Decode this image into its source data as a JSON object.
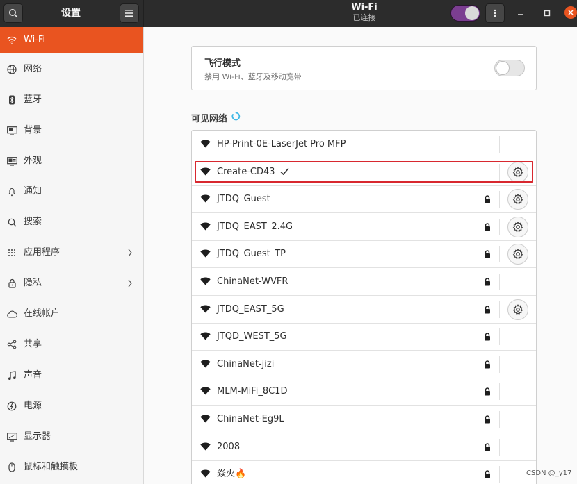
{
  "header": {
    "settings_title": "设置",
    "page_title": "Wi-Fi",
    "page_subtitle": "已连接",
    "wifi_enabled": true
  },
  "sidebar": {
    "items": [
      {
        "label": "Wi-Fi",
        "icon": "wifi-icon",
        "active": true
      },
      {
        "label": "网络",
        "icon": "network-icon"
      },
      {
        "label": "蓝牙",
        "icon": "bluetooth-icon"
      },
      {
        "label": "背景",
        "icon": "background-icon"
      },
      {
        "label": "外观",
        "icon": "appearance-icon"
      },
      {
        "label": "通知",
        "icon": "bell-icon"
      },
      {
        "label": "搜索",
        "icon": "search-icon"
      },
      {
        "label": "应用程序",
        "icon": "apps-grid-icon",
        "has_arrow": true
      },
      {
        "label": "隐私",
        "icon": "lock-icon",
        "has_arrow": true
      },
      {
        "label": "在线帐户",
        "icon": "cloud-icon"
      },
      {
        "label": "共享",
        "icon": "share-icon"
      },
      {
        "label": "声音",
        "icon": "music-note-icon"
      },
      {
        "label": "电源",
        "icon": "power-icon"
      },
      {
        "label": "显示器",
        "icon": "display-icon"
      },
      {
        "label": "鼠标和触摸板",
        "icon": "mouse-icon"
      }
    ]
  },
  "airplane": {
    "title": "飞行模式",
    "description": "禁用 Wi-Fi、蓝牙及移动宽带",
    "enabled": false
  },
  "networks_section": {
    "title": "可见网络"
  },
  "networks": [
    {
      "name": "HP-Print-0E-LaserJet Pro MFP",
      "locked": false,
      "has_settings": false,
      "connected": false
    },
    {
      "name": "Create-CD43",
      "locked": false,
      "has_settings": true,
      "connected": true
    },
    {
      "name": "JTDQ_Guest",
      "locked": true,
      "has_settings": true,
      "connected": false
    },
    {
      "name": "JTDQ_EAST_2.4G",
      "locked": true,
      "has_settings": true,
      "connected": false
    },
    {
      "name": "JTDQ_Guest_TP",
      "locked": true,
      "has_settings": true,
      "connected": false
    },
    {
      "name": "ChinaNet-WVFR",
      "locked": true,
      "has_settings": false,
      "connected": false
    },
    {
      "name": "JTDQ_EAST_5G",
      "locked": true,
      "has_settings": true,
      "connected": false
    },
    {
      "name": "JTQD_WEST_5G",
      "locked": true,
      "has_settings": false,
      "connected": false
    },
    {
      "name": "ChinaNet-jizi",
      "locked": true,
      "has_settings": false,
      "connected": false
    },
    {
      "name": "MLM-MiFi_8C1D",
      "locked": true,
      "has_settings": false,
      "connected": false
    },
    {
      "name": "ChinaNet-Eg9L",
      "locked": true,
      "has_settings": false,
      "connected": false
    },
    {
      "name": "2008",
      "locked": true,
      "has_settings": false,
      "connected": false
    },
    {
      "name": "焱火🔥",
      "locked": true,
      "has_settings": false,
      "connected": false
    }
  ],
  "watermark": "CSDN @_y17",
  "colors": {
    "accent": "#e95420",
    "header_bg": "#2c2c2c",
    "toggle_on": "#7b3e91",
    "highlight": "#d8282f"
  }
}
